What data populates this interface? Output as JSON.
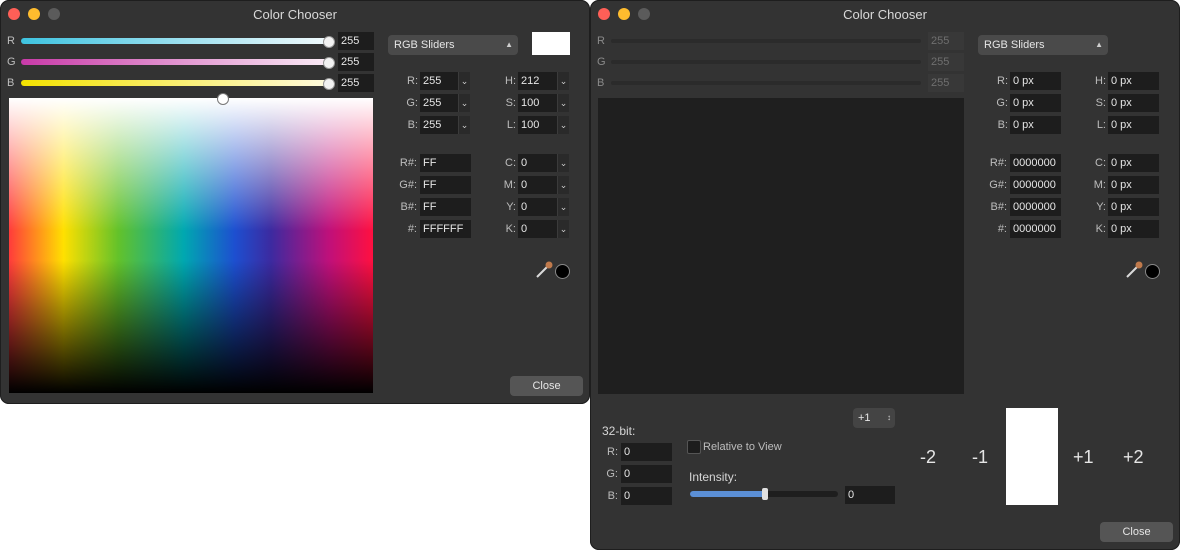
{
  "left_window": {
    "title": "Color Chooser",
    "sliders": [
      {
        "label": "R",
        "value": "255"
      },
      {
        "label": "G",
        "value": "255"
      },
      {
        "label": "B",
        "value": "255"
      }
    ],
    "mode_dropdown": "RGB Sliders",
    "swatch_color": "#ffffff",
    "fields_left": [
      {
        "label": "R:",
        "value": "255"
      },
      {
        "label": "G:",
        "value": "255"
      },
      {
        "label": "B:",
        "value": "255"
      }
    ],
    "fields_right": [
      {
        "label": "H:",
        "value": "212"
      },
      {
        "label": "S:",
        "value": "100"
      },
      {
        "label": "L:",
        "value": "100"
      }
    ],
    "hex_fields": [
      {
        "label": "R#:",
        "value": "FF"
      },
      {
        "label": "G#:",
        "value": "FF"
      },
      {
        "label": "B#:",
        "value": "FF"
      },
      {
        "label": "#:",
        "value": "FFFFFF"
      }
    ],
    "cmyk_fields": [
      {
        "label": "C:",
        "value": "0"
      },
      {
        "label": "M:",
        "value": "0"
      },
      {
        "label": "Y:",
        "value": "0"
      },
      {
        "label": "K:",
        "value": "0"
      }
    ],
    "close_label": "Close"
  },
  "right_window": {
    "title": "Color Chooser",
    "sliders": [
      {
        "label": "R",
        "value": "255"
      },
      {
        "label": "G",
        "value": "255"
      },
      {
        "label": "B",
        "value": "255"
      }
    ],
    "mode_dropdown": "RGB Sliders",
    "fields_left": [
      {
        "label": "R:",
        "value": "0 px"
      },
      {
        "label": "G:",
        "value": "0 px"
      },
      {
        "label": "B:",
        "value": "0 px"
      }
    ],
    "fields_right": [
      {
        "label": "H:",
        "value": "0 px"
      },
      {
        "label": "S:",
        "value": "0 px"
      },
      {
        "label": "L:",
        "value": "0 px"
      }
    ],
    "hex_fields": [
      {
        "label": "R#:",
        "value": "0000000"
      },
      {
        "label": "G#:",
        "value": "0000000"
      },
      {
        "label": "B#:",
        "value": "0000000"
      },
      {
        "label": "#:",
        "value": "0000000"
      }
    ],
    "cmyk_fields": [
      {
        "label": "C:",
        "value": "0 px"
      },
      {
        "label": "M:",
        "value": "0 px"
      },
      {
        "label": "Y:",
        "value": "0 px"
      },
      {
        "label": "K:",
        "value": "0 px"
      }
    ],
    "bit32": {
      "heading": "32-bit:",
      "fields": [
        {
          "label": "R:",
          "value": "0"
        },
        {
          "label": "G:",
          "value": "0"
        },
        {
          "label": "B:",
          "value": "0"
        }
      ]
    },
    "relative_to_view": "Relative to View",
    "stepper_value": "+1",
    "intensity": {
      "label": "Intensity:",
      "value": "0"
    },
    "exposure_labels": [
      "-2",
      "-1",
      "+1",
      "+2"
    ],
    "close_label": "Close"
  }
}
